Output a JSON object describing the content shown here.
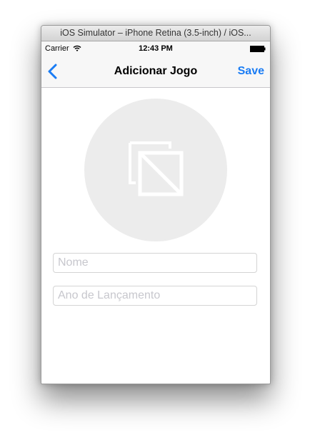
{
  "window": {
    "title": "iOS Simulator – iPhone Retina (3.5-inch) / iOS..."
  },
  "status_bar": {
    "carrier": "Carrier",
    "time": "12:43 PM",
    "wifi_icon": "wifi-icon",
    "battery_icon": "battery-icon"
  },
  "nav_bar": {
    "back_icon": "chevron-left-icon",
    "title": "Adicionar Jogo",
    "save_label": "Save",
    "accent_color": "#1a7cf4"
  },
  "form": {
    "image_placeholder_icon": "image-placeholder-icon",
    "name_field": {
      "value": "",
      "placeholder": "Nome"
    },
    "year_field": {
      "value": "",
      "placeholder": "Ano de Lançamento"
    }
  }
}
